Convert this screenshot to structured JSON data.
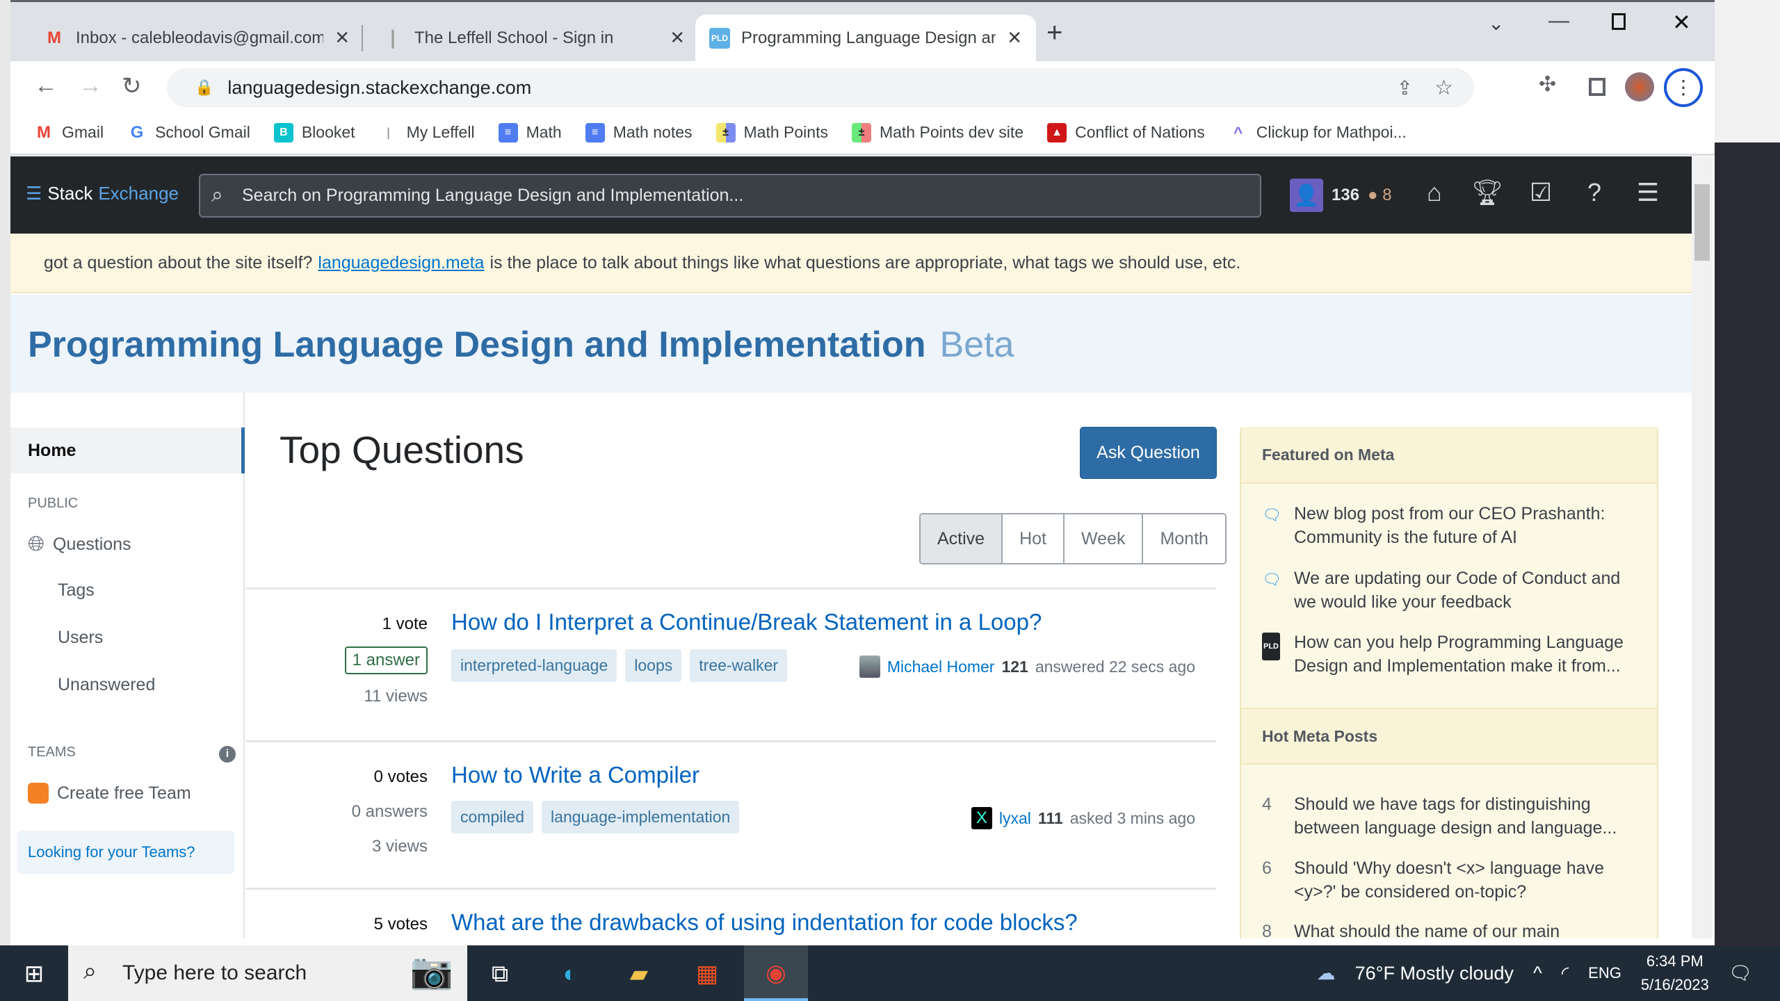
{
  "browser": {
    "tabs": [
      {
        "title": "Inbox - calebleodavis@gmail.com",
        "icon": "gmail-icon",
        "active": false
      },
      {
        "title": "The Leffell School - Sign in",
        "icon": "leffell-icon",
        "active": false
      },
      {
        "title": "Programming Language Design and Implementation",
        "icon": "pld-icon",
        "active": true
      }
    ],
    "new_tab": "+",
    "url": "languagedesign.stackexchange.com",
    "bookmarks": [
      {
        "label": "Gmail",
        "icon": "gmail-icon",
        "color": "#ea4335",
        "glyph": "M"
      },
      {
        "label": "School Gmail",
        "icon": "google-icon",
        "color": "#4285f4",
        "glyph": "G"
      },
      {
        "label": "Blooket",
        "icon": "blooket-icon",
        "color": "#0bc2cf",
        "glyph": "B"
      },
      {
        "label": "My Leffell",
        "icon": "leffell-icon",
        "color": "#9e9e9e",
        "glyph": "❘"
      },
      {
        "label": "Math",
        "icon": "docs-icon",
        "color": "#4f7cf0",
        "glyph": "≡"
      },
      {
        "label": "Math notes",
        "icon": "docs-icon",
        "color": "#4f7cf0",
        "glyph": "≡"
      },
      {
        "label": "Math Points",
        "icon": "calculator-icon",
        "color": "#6a6a6a",
        "glyph": "±"
      },
      {
        "label": "Math Points dev site",
        "icon": "calculator-icon",
        "color": "#6a6a6a",
        "glyph": "±"
      },
      {
        "label": "Conflict of Nations",
        "icon": "con-icon",
        "color": "#d01818",
        "glyph": "▲"
      },
      {
        "label": "Clickup for Mathpoi...",
        "icon": "clickup-icon",
        "color": "#7b68ee",
        "glyph": "^"
      }
    ]
  },
  "topbar": {
    "logo_a": "Stack",
    "logo_b": "Exchange",
    "search_placeholder": "Search on Programming Language Design and Implementation...",
    "reputation": "136",
    "bronze_badges": "8"
  },
  "banner": {
    "pre": "got a question about the site itself?",
    "link": "languagedesign.meta",
    "post": "is the place to talk about things like what questions are appropriate, what tags we should use, etc."
  },
  "site": {
    "title": "Programming Language Design and Implementation",
    "beta": "Beta"
  },
  "leftnav": {
    "home": "Home",
    "public": "PUBLIC",
    "questions": "Questions",
    "tags": "Tags",
    "users": "Users",
    "unanswered": "Unanswered",
    "teams": "TEAMS",
    "create_team": "Create free Team",
    "looking": "Looking for your Teams?"
  },
  "main": {
    "heading": "Top Questions",
    "ask": "Ask Question",
    "filters": [
      {
        "label": "Active",
        "selected": true
      },
      {
        "label": "Hot",
        "selected": false
      },
      {
        "label": "Week",
        "selected": false
      },
      {
        "label": "Month",
        "selected": false
      }
    ],
    "questions": [
      {
        "votes": "1 vote",
        "answers": "1 answer",
        "answered": true,
        "views": "11 views",
        "title": "How do I Interpret a Continue/Break Statement in a Loop?",
        "tags": [
          "interpreted-language",
          "loops",
          "tree-walker"
        ],
        "user": "Michael Homer",
        "rep": "121",
        "action": "answered 22 secs ago"
      },
      {
        "votes": "0 votes",
        "answers": "0 answers",
        "answered": false,
        "views": "3 views",
        "title": "How to Write a Compiler",
        "tags": [
          "compiled",
          "language-implementation"
        ],
        "user": "lyxal",
        "rep": "111",
        "action": "asked 3 mins ago"
      },
      {
        "votes": "5 votes",
        "title": "What are the drawbacks of using indentation for code blocks?"
      }
    ]
  },
  "sidebar": {
    "featured_title": "Featured on Meta",
    "featured": [
      {
        "text": "New blog post from our CEO Prashanth: Community is the future of AI",
        "icon": "blog-icon"
      },
      {
        "text": "We are updating our Code of Conduct and we would like your feedback",
        "icon": "blog-icon"
      },
      {
        "text": "How can you help Programming Language Design and Implementation make it from...",
        "icon": "pld-icon"
      }
    ],
    "hot_title": "Hot Meta Posts",
    "hot": [
      {
        "score": "4",
        "text": "Should we have tags for distinguishing between language design and language..."
      },
      {
        "score": "6",
        "text": "Should 'Why doesn't <x> language have <y>?' be considered on-topic?"
      },
      {
        "score": "8",
        "text": "What should the name of our main"
      }
    ]
  },
  "taskbar": {
    "search_placeholder": "Type here to search",
    "weather": "76°F  Mostly cloudy",
    "lang": "ENG",
    "time": "6:34 PM",
    "date": "5/16/2023"
  },
  "colors": {
    "accent": "#2e6ca5",
    "link": "#0063bf",
    "tag_bg": "#e1ecf4",
    "answered": "#2f6f44"
  }
}
